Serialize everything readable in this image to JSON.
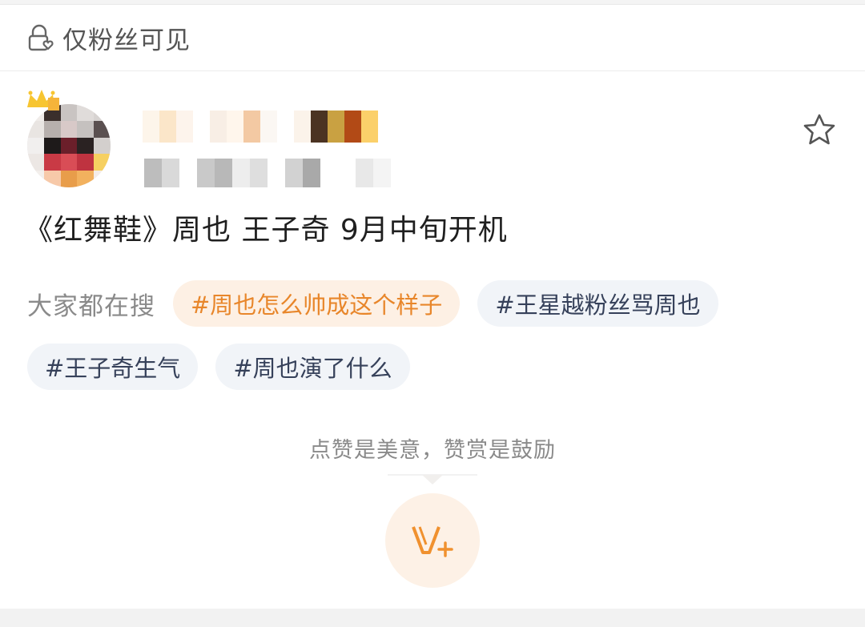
{
  "visibility": {
    "icon": "lock-user-icon",
    "label": "仅粉丝可见"
  },
  "post": {
    "author": {
      "avatar_icon": "crown-icon",
      "name_hidden": true
    },
    "favorite_icon": "star-outline-icon",
    "title": "《红舞鞋》周也  王子奇 9月中旬开机"
  },
  "search": {
    "label": "大家都在搜",
    "tags": [
      {
        "text": "#周也怎么帅成这个样子",
        "style": "hot"
      },
      {
        "text": "#王星越粉丝骂周也",
        "style": "normal"
      },
      {
        "text": "#王子奇生气",
        "style": "normal"
      },
      {
        "text": "#周也演了什么",
        "style": "normal"
      }
    ]
  },
  "reward": {
    "prompt": "点赞是美意，赞赏是鼓励",
    "icon": "v-plus-icon"
  },
  "colors": {
    "hot_tag_text": "#e8862a",
    "hot_tag_bg": "#fdf0e4",
    "normal_tag_text": "#36415a",
    "normal_tag_bg": "#f1f4f8",
    "reward_accent": "#f0912f"
  }
}
